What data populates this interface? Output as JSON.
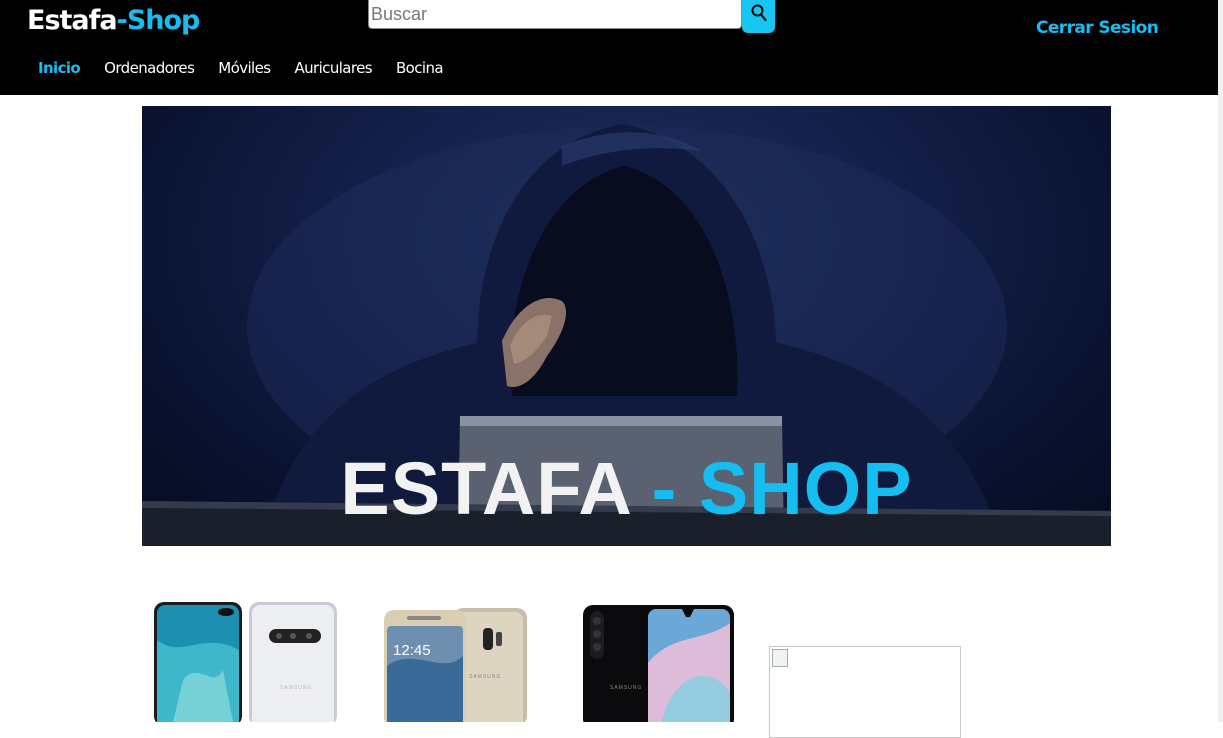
{
  "header": {
    "logo_main": "Estafa",
    "logo_accent": "-Shop",
    "search_placeholder": "Buscar",
    "search_icon": "search-icon",
    "logout_label": "Cerrar Sesion"
  },
  "nav": {
    "items": [
      {
        "label": "Inicio",
        "active": true
      },
      {
        "label": "Ordenadores",
        "active": false
      },
      {
        "label": "Móviles",
        "active": false
      },
      {
        "label": "Auriculares",
        "active": false
      },
      {
        "label": "Bocina",
        "active": false
      }
    ]
  },
  "banner": {
    "title_main": "ESTAFA",
    "title_accent": " - SHOP"
  },
  "products": [
    {
      "brand": "SAMSUNG"
    },
    {
      "brand": "SAMSUNG",
      "screen_time": "12:45"
    },
    {
      "brand": "SAMSUNG"
    }
  ],
  "colors": {
    "accent": "#16bdf0",
    "header_bg": "#000000",
    "banner_bg": "#142049"
  }
}
